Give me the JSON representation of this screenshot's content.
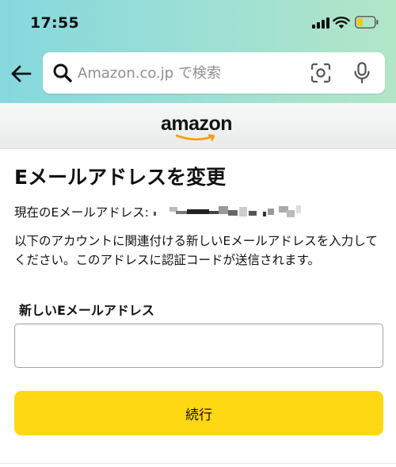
{
  "status_bar": {
    "time": "17:55"
  },
  "search": {
    "placeholder": "Amazon.co.jp で検索"
  },
  "logo": {
    "text": "amazon"
  },
  "page": {
    "title": "Eメールアドレスを変更",
    "current_email_label": "現在のEメールアドレス:",
    "instructions": "以下のアカウントに関連付ける新しいEメールアドレスを入力してください。このアドレスに認証コードが送信されます。",
    "field_label": "新しいEメールアドレス",
    "email_value": "",
    "continue_label": "続行"
  },
  "colors": {
    "header_gradient_start": "#86d8de",
    "header_gradient_end": "#b2e6c6",
    "button_yellow": "#ffd814",
    "logo_smile": "#ff9900"
  },
  "icons": [
    "back-arrow-icon",
    "search-icon",
    "camera-icon",
    "microphone-icon",
    "signal-icon",
    "wifi-icon",
    "battery-icon",
    "amazon-smile-icon"
  ]
}
